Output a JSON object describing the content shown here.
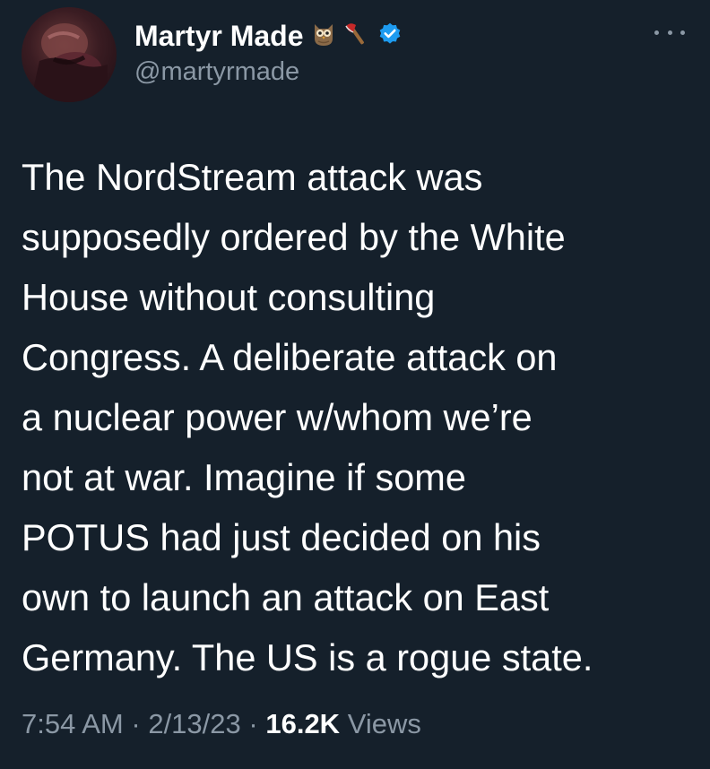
{
  "tweet": {
    "author": {
      "display_name": "Martyr Made",
      "name_emojis": [
        "owl-icon",
        "axe-icon"
      ],
      "verified": true,
      "handle": "@martyrmade"
    },
    "text": "The NordStream attack was\nsupposedly ordered by the White\nHouse without consulting\nCongress. A deliberate attack on\na nuclear power w/whom we’re\nnot at war. Imagine if some\nPOTUS had just decided on his\nown to launch an attack on East\nGermany. The US is a rogue state.",
    "time": "7:54 AM",
    "date": "2/13/23",
    "views_count": "16.2K",
    "views_label": "Views",
    "separator": "·"
  },
  "colors": {
    "background": "#15202b",
    "text": "#ffffff",
    "secondary": "#8b98a5",
    "verified": "#1d9bf0"
  }
}
